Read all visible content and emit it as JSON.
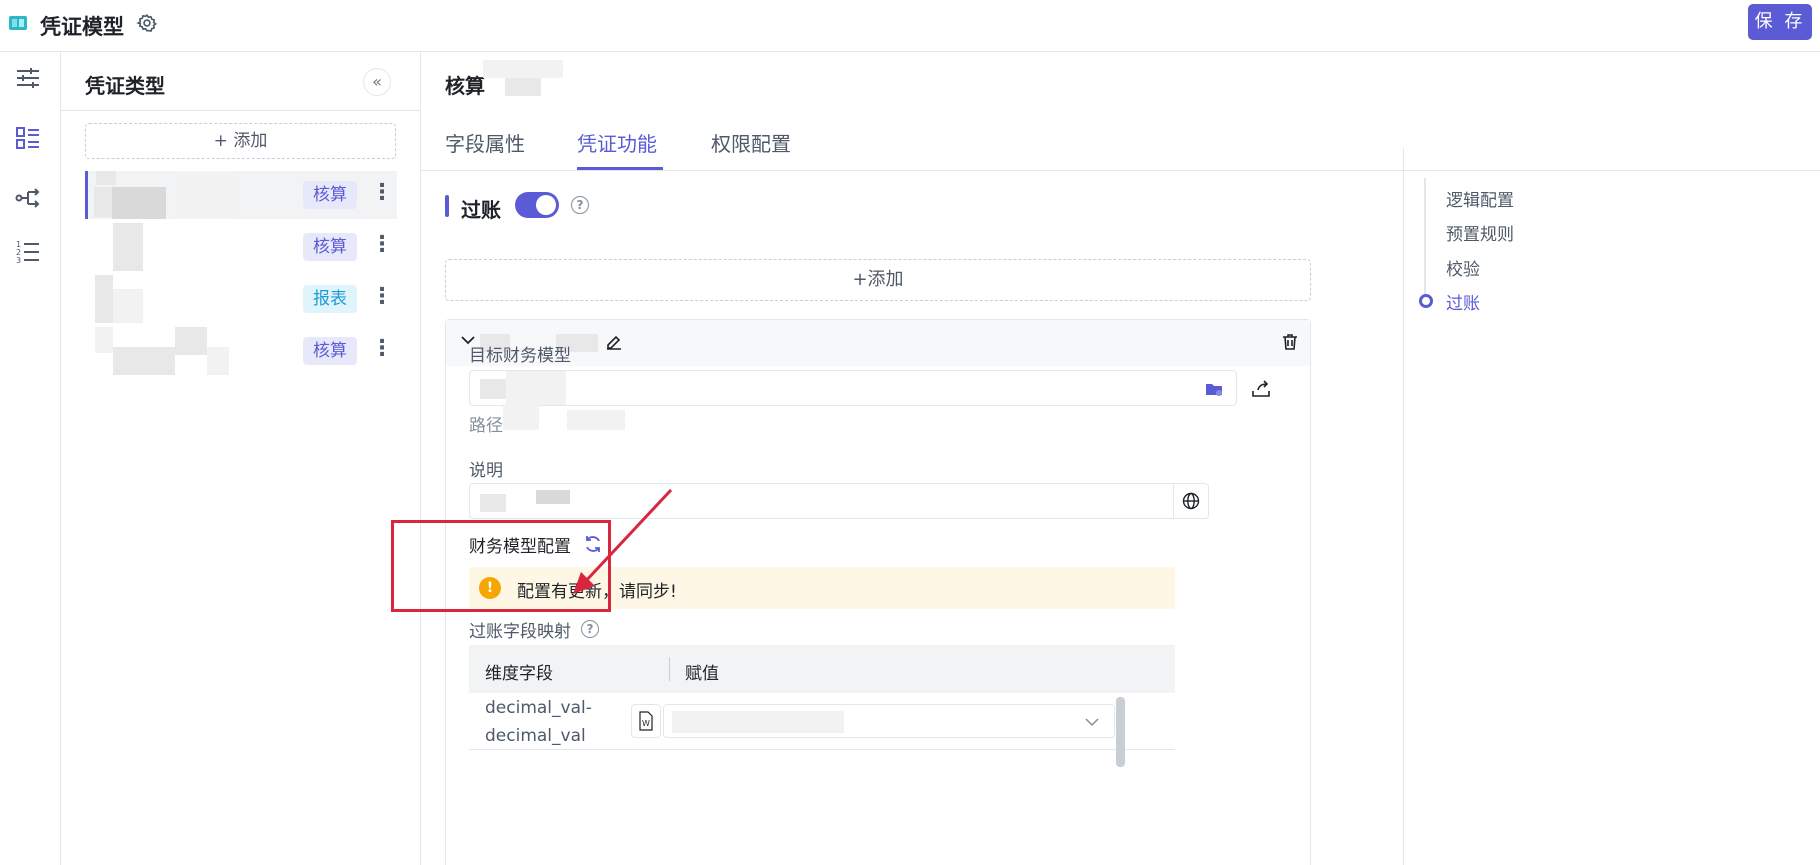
{
  "app": {
    "title": "凭证模型",
    "save_label": "保 存"
  },
  "type_panel": {
    "title": "凭证类型",
    "add_label": "+ 添加",
    "items": [
      {
        "tag": "核算",
        "tag_color": "purple"
      },
      {
        "tag": "核算",
        "tag_color": "purple"
      },
      {
        "tag": "报表",
        "tag_color": "cyan"
      },
      {
        "tag": "核算",
        "tag_color": "purple"
      }
    ]
  },
  "main": {
    "title": "核算",
    "tabs": [
      "字段属性",
      "凭证功能",
      "权限配置"
    ],
    "active_tab": "凭证功能",
    "section": {
      "title": "过账",
      "enabled": true
    },
    "add_label": "+添加",
    "card": {
      "target_model_label": "目标财务模型",
      "path_label": "路径",
      "desc_label": "说明",
      "finance_config_label": "财务模型配置",
      "alert_text": "配置有更新，请同步!",
      "mapping_label": "过账字段映射",
      "table": {
        "headers": [
          "维度字段",
          "赋值"
        ],
        "rows": [
          {
            "field": "decimal_val-\ndecimal_val"
          }
        ]
      }
    }
  },
  "anchor_nav": {
    "items": [
      "逻辑配置",
      "预置规则",
      "校验",
      "过账"
    ],
    "active": "过账"
  },
  "colors": {
    "accent": "#5b5bd6",
    "warning": "#f7a501",
    "highlight": "#d7263d"
  }
}
